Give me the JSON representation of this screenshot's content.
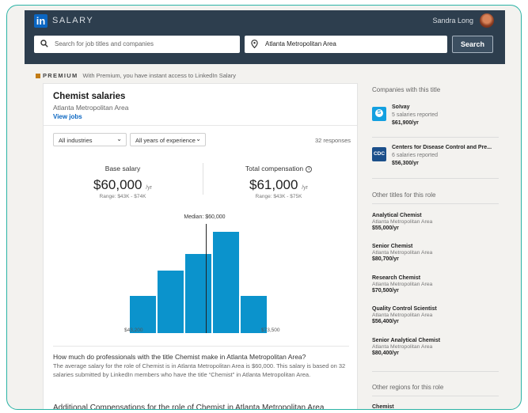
{
  "nav": {
    "logo_text": "in",
    "brand": "SALARY",
    "user_name": "Sandra Long",
    "search_placeholder": "Search for job titles and companies",
    "location_value": "Atlanta Metropolitan Area",
    "search_button": "Search"
  },
  "premium": {
    "label": "PREMIUM",
    "text": "With Premium, you have instant access to LinkedIn Salary"
  },
  "main": {
    "title": "Chemist salaries",
    "location": "Atlanta Metropolitan Area",
    "view_jobs": "View jobs",
    "filter_industry": "All industries",
    "filter_experience": "All years of experience",
    "responses": "32 responses",
    "base": {
      "label": "Base salary",
      "value": "$60,000",
      "unit": "/yr",
      "range": "Range: $43K - $74K"
    },
    "total": {
      "label": "Total compensation",
      "value": "$61,000",
      "unit": "/yr",
      "range": "Range: $43K - $75K"
    },
    "question": "How much do professionals with the title Chemist make in Atlanta Metropolitan Area?",
    "answer": "The average salary for the role of Chemist is in Atlanta Metropolitan Area is $60,000. This salary is based on 32 salaries submitted by LinkedIn members who have the title “Chemist” in Atlanta Metropolitan Area.",
    "additional": "Additional Compensations for the role of Chemist in Atlanta Metropolitan Area"
  },
  "chart_data": {
    "type": "bar",
    "median_label": "Median: $60,000",
    "x_min_label": "$43,200",
    "x_max_label": "$73,500",
    "values": [
      0.37,
      0.62,
      0.78,
      1.0,
      0.37
    ],
    "median_position": 0.56,
    "color": "#0b93cc"
  },
  "rail": {
    "companies_heading": "Companies with this title",
    "companies": [
      {
        "logo": "S",
        "name": "Solvay",
        "reported": "5 salaries reported",
        "salary": "$61,900/yr"
      },
      {
        "logo": "CDC",
        "name": "Centers for Disease Control and Pre...",
        "reported": "6 salaries reported",
        "salary": "$56,300/yr"
      }
    ],
    "other_titles_heading": "Other titles for this role",
    "titles": [
      {
        "name": "Analytical Chemist",
        "location": "Atlanta Metropolitan Area",
        "salary": "$55,000/yr"
      },
      {
        "name": "Senior Chemist",
        "location": "Atlanta Metropolitan Area",
        "salary": "$80,700/yr"
      },
      {
        "name": "Research Chemist",
        "location": "Atlanta Metropolitan Area",
        "salary": "$70,500/yr"
      },
      {
        "name": "Quality Control Scientist",
        "location": "Atlanta Metropolitan Area",
        "salary": "$56,400/yr"
      },
      {
        "name": "Senior Analytical Chemist",
        "location": "Atlanta Metropolitan Area",
        "salary": "$80,400/yr"
      }
    ],
    "other_regions_heading": "Other regions for this role",
    "regions": [
      {
        "name": "Chemist"
      }
    ]
  }
}
